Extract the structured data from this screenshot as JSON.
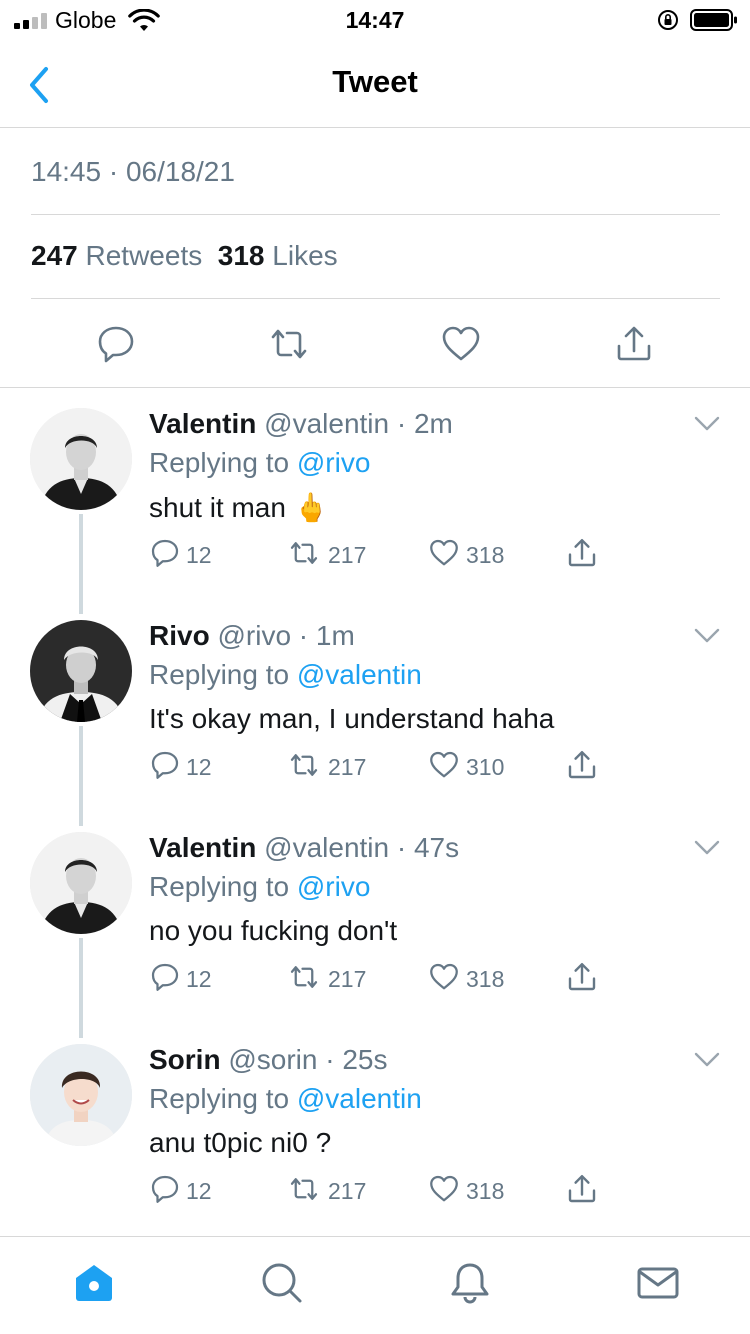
{
  "status_bar": {
    "carrier": "Globe",
    "time": "14:47"
  },
  "nav": {
    "title": "Tweet",
    "back_icon": "chevron-left-icon"
  },
  "tweet": {
    "timestamp": "14:45 · 06/18/21",
    "retweets_count": "247",
    "retweets_label": "Retweets",
    "likes_count": "318",
    "likes_label": "Likes",
    "actions": [
      "reply-icon",
      "retweet-icon",
      "like-icon",
      "share-icon"
    ]
  },
  "replies": [
    {
      "name": "Valentin",
      "handle": "@valentin",
      "time": "2m",
      "replying_prefix": "Replying to",
      "replying_to": "@rivo",
      "text": "shut it man 🖕",
      "replies": "12",
      "retweets": "217",
      "likes": "318"
    },
    {
      "name": "Rivo",
      "handle": "@rivo",
      "time": "1m",
      "replying_prefix": "Replying to",
      "replying_to": "@valentin",
      "text": "It's okay man, I understand haha",
      "replies": "12",
      "retweets": "217",
      "likes": "310"
    },
    {
      "name": "Valentin",
      "handle": "@valentin",
      "time": "47s",
      "replying_prefix": "Replying to",
      "replying_to": "@rivo",
      "text": "no you fucking don't",
      "replies": "12",
      "retweets": "217",
      "likes": "318"
    },
    {
      "name": "Sorin",
      "handle": "@sorin",
      "time": "25s",
      "replying_prefix": "Replying to",
      "replying_to": "@valentin",
      "text": "anu t0pic ni0 ?",
      "replies": "12",
      "retweets": "217",
      "likes": "318"
    }
  ],
  "tab_bar": {
    "tabs": [
      "home-icon",
      "search-icon",
      "notifications-icon",
      "messages-icon"
    ],
    "active": "home-icon"
  },
  "colors": {
    "accent": "#1da1f2",
    "secondary_text": "#657786",
    "divider": "#d8d8d8",
    "thread_line": "#cfd9de"
  }
}
